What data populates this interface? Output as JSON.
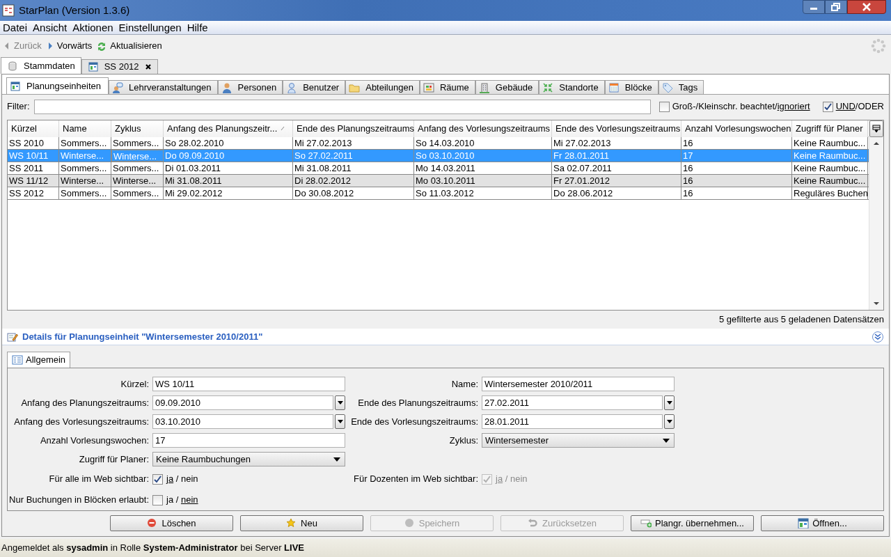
{
  "window": {
    "title": "StarPlan (Version 1.3.6)"
  },
  "menu": [
    "Datei",
    "Ansicht",
    "Aktionen",
    "Einstellungen",
    "Hilfe"
  ],
  "toolbar": [
    {
      "kind": "back",
      "label": "Zurück",
      "disabled": true
    },
    {
      "kind": "forward",
      "label": "Vorwärts",
      "disabled": false
    },
    {
      "kind": "refresh",
      "label": "Aktualisieren",
      "disabled": false
    }
  ],
  "doc_tabs": [
    {
      "kind": "data",
      "label": "Stammdaten",
      "selected": true,
      "closable": false
    },
    {
      "kind": "plan",
      "label": "SS 2012",
      "selected": false,
      "closable": true
    }
  ],
  "sub_tabs": [
    {
      "kind": "plan",
      "label": "Planungseinheiten",
      "selected": true
    },
    {
      "kind": "lecture",
      "label": "Lehrveranstaltungen",
      "selected": false
    },
    {
      "kind": "person",
      "label": "Personen",
      "selected": false
    },
    {
      "kind": "user",
      "label": "Benutzer",
      "selected": false
    },
    {
      "kind": "folder",
      "label": "Abteilungen",
      "selected": false
    },
    {
      "kind": "room",
      "label": "Räume",
      "selected": false
    },
    {
      "kind": "building",
      "label": "Gebäude",
      "selected": false
    },
    {
      "kind": "arrows",
      "label": "Standorte",
      "selected": false
    },
    {
      "kind": "calendar",
      "label": "Blöcke",
      "selected": false
    },
    {
      "kind": "tag",
      "label": "Tags",
      "selected": false
    }
  ],
  "filter": {
    "label": "Filter:",
    "case_option": {
      "checked": false,
      "label": "Groß-/Kleinschr. beachtet/",
      "choice": "ignoriert"
    },
    "logic_option": {
      "checked": true,
      "choice": "UND",
      "label": "/ODER"
    }
  },
  "table": {
    "columns": [
      {
        "label": "Kürzel",
        "sorted": false
      },
      {
        "label": "Name",
        "sorted": false
      },
      {
        "label": "Zyklus",
        "sorted": false
      },
      {
        "label": "Anfang des Planungszeitr...",
        "sorted": true
      },
      {
        "label": "Ende des Planungszeitraums",
        "sorted": false
      },
      {
        "label": "Anfang des Vorlesungszeitraums",
        "sorted": false
      },
      {
        "label": "Ende des Vorlesungszeitraums",
        "sorted": false
      },
      {
        "label": "Anzahl Vorlesungswochen",
        "sorted": false
      },
      {
        "label": "Zugriff für Planer",
        "sorted": false
      }
    ],
    "rows": [
      {
        "selected": false,
        "cells": [
          {
            "text": "SS 2010",
            "focused": false
          },
          {
            "text": "Sommers...",
            "focused": false
          },
          {
            "text": "Sommers...",
            "focused": false
          },
          {
            "text": "So 28.02.2010",
            "focused": false
          },
          {
            "text": "Mi 27.02.2013",
            "focused": false
          },
          {
            "text": "So 14.03.2010",
            "focused": false
          },
          {
            "text": "Mi 27.02.2013",
            "focused": false
          },
          {
            "text": "16",
            "focused": false
          },
          {
            "text": "Keine Raumbuc...",
            "focused": false
          }
        ]
      },
      {
        "selected": true,
        "cells": [
          {
            "text": "WS 10/11",
            "focused": false
          },
          {
            "text": "Winterse...",
            "focused": false
          },
          {
            "text": "Winterse...",
            "focused": true
          },
          {
            "text": "Do 09.09.2010",
            "focused": false
          },
          {
            "text": "So 27.02.2011",
            "focused": false
          },
          {
            "text": "So 03.10.2010",
            "focused": false
          },
          {
            "text": "Fr 28.01.2011",
            "focused": false
          },
          {
            "text": "17",
            "focused": false
          },
          {
            "text": "Keine Raumbuc...",
            "focused": false
          }
        ]
      },
      {
        "selected": false,
        "cells": [
          {
            "text": "SS 2011",
            "focused": false
          },
          {
            "text": "Sommers...",
            "focused": false
          },
          {
            "text": "Sommers...",
            "focused": false
          },
          {
            "text": "Di 01.03.2011",
            "focused": false
          },
          {
            "text": "Mi 31.08.2011",
            "focused": false
          },
          {
            "text": "Mo 14.03.2011",
            "focused": false
          },
          {
            "text": "Sa 02.07.2011",
            "focused": false
          },
          {
            "text": "16",
            "focused": false
          },
          {
            "text": "Keine Raumbuc...",
            "focused": false
          }
        ]
      },
      {
        "selected": false,
        "cells": [
          {
            "text": "WS 11/12",
            "focused": false
          },
          {
            "text": "Winterse...",
            "focused": false
          },
          {
            "text": "Winterse...",
            "focused": false
          },
          {
            "text": "Mi 31.08.2011",
            "focused": false
          },
          {
            "text": "Di 28.02.2012",
            "focused": false
          },
          {
            "text": "Mo 03.10.2011",
            "focused": false
          },
          {
            "text": "Fr 27.01.2012",
            "focused": false
          },
          {
            "text": "16",
            "focused": false
          },
          {
            "text": "Keine Raumbuc...",
            "focused": false
          }
        ]
      },
      {
        "selected": false,
        "cells": [
          {
            "text": "SS 2012",
            "focused": false
          },
          {
            "text": "Sommers...",
            "focused": false
          },
          {
            "text": "Sommers...",
            "focused": false
          },
          {
            "text": "Mi 29.02.2012",
            "focused": false
          },
          {
            "text": "Do 30.08.2012",
            "focused": false
          },
          {
            "text": "So 11.03.2012",
            "focused": false
          },
          {
            "text": "Do 28.06.2012",
            "focused": false
          },
          {
            "text": "16",
            "focused": false
          },
          {
            "text": "Reguläres Buchen",
            "focused": false
          }
        ]
      }
    ],
    "count": "5 gefilterte aus 5 geladenen Datensätzen"
  },
  "details": {
    "title": "Details für Planungseinheit \"Wintersemester 2010/2011\"",
    "tabs": [
      {
        "label": "Allgemein",
        "selected": true
      }
    ],
    "rows": [
      [
        {
          "kind": "text",
          "label": "Kürzel:",
          "value": "WS 10/11"
        },
        {
          "kind": "text",
          "label": "Name:",
          "value": "Wintersemester 2010/2011"
        }
      ],
      [
        {
          "kind": "date",
          "label": "Anfang des Planungszeitraums:",
          "value": "09.09.2010"
        },
        {
          "kind": "date",
          "label": "Ende des Planungszeitraums:",
          "value": "27.02.2011"
        }
      ],
      [
        {
          "kind": "date",
          "label": "Anfang des Vorlesungszeitraums:",
          "value": "03.10.2010"
        },
        {
          "kind": "date",
          "label": "Ende des Vorlesungszeitraums:",
          "value": "28.01.2011"
        }
      ],
      [
        {
          "kind": "text",
          "label": "Anzahl Vorlesungswochen:",
          "value": "17"
        },
        {
          "kind": "select",
          "label": "Zyklus:",
          "value": "Wintersemester"
        }
      ],
      [
        {
          "kind": "select",
          "label": "Zugriff für Planer:",
          "value": "Keine Raumbuchungen"
        }
      ],
      [
        {
          "kind": "check",
          "label": "Für alle im Web sichtbar:",
          "checked": true,
          "disabled": false,
          "yes": "ja",
          "separator": "/",
          "no": "nein"
        },
        {
          "kind": "check",
          "label": "Für Dozenten im Web sichtbar:",
          "checked": true,
          "disabled": true,
          "yes": "ja",
          "separator": "/",
          "no": "nein"
        }
      ],
      [
        {
          "kind": "check",
          "label": "Nur Buchungen in Blöcken erlaubt:",
          "checked": false,
          "disabled": false,
          "yes": "ja",
          "separator": "/",
          "no": "nein"
        }
      ]
    ],
    "buttons": [
      {
        "kind": "delete",
        "label": "Löschen",
        "disabled": false
      },
      {
        "kind": "star",
        "label": "Neu",
        "disabled": false
      },
      {
        "kind": "save",
        "label": "Speichern",
        "disabled": true
      },
      {
        "kind": "undo",
        "label": "Zurücksetzen",
        "disabled": true
      },
      {
        "kind": "adopt",
        "label": "Plangr. übernehmen...",
        "disabled": false
      },
      {
        "kind": "open",
        "label": "Öffnen...",
        "disabled": false
      }
    ]
  },
  "status_bar": "Angemeldet als **sysadmin** in Rolle **System-Administrator** bei Server **LIVE**"
}
